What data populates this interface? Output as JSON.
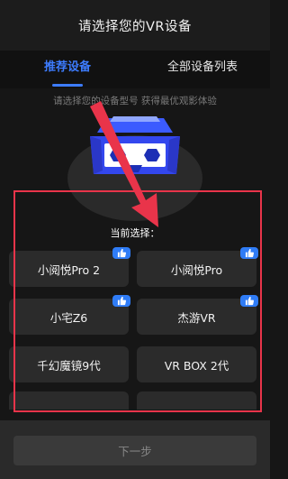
{
  "header": {
    "title": "请选择您的VR设备"
  },
  "tabs": [
    {
      "label": "推荐设备",
      "active": true
    },
    {
      "label": "全部设备列表",
      "active": false
    }
  ],
  "subtitle": "请选择您的设备型号  获得最优观影体验",
  "current_label": "当前选择：",
  "devices": [
    {
      "label": "小阅悦Pro 2",
      "badge": "thumbs-up-icon"
    },
    {
      "label": "小阅悦Pro",
      "badge": "thumbs-up-icon"
    },
    {
      "label": "小宅Z6",
      "badge": "thumbs-up-icon"
    },
    {
      "label": "杰游VR",
      "badge": "thumbs-up-icon"
    },
    {
      "label": "千幻魔镜9代"
    },
    {
      "label": "VR BOX 2代"
    }
  ],
  "footer": {
    "next_label": "下一步"
  },
  "colors": {
    "accent": "#3d7cff",
    "highlight": "#e9344a",
    "background": "#161616"
  }
}
